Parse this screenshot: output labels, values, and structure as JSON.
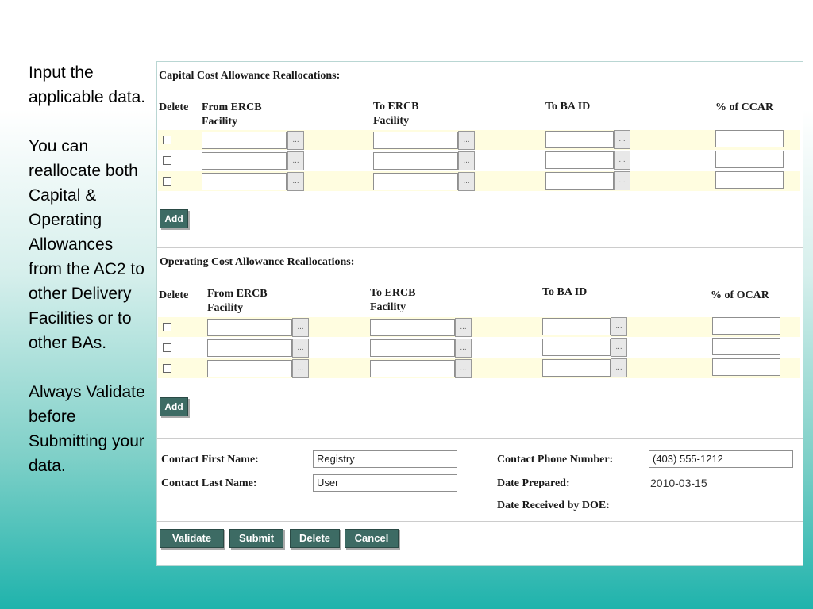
{
  "notes": {
    "p1": "Input the applicable data.",
    "p2": "You can reallocate both Capital & Operating Allowances from the AC2 to other Delivery Facilities or to other BAs.",
    "p3": "Always Validate before Submitting your data."
  },
  "capital": {
    "title": "Capital Cost Allowance Reallocations:",
    "col_delete": "Delete",
    "col_from": "From ERCB Facility",
    "col_to": "To ERCB Facility",
    "col_ba": "To BA ID",
    "col_pct": "% of CCAR",
    "lookup_label": "...",
    "add_label": "Add"
  },
  "operating": {
    "title": "Operating Cost Allowance Reallocations:",
    "col_delete": "Delete",
    "col_from": "From ERCB Facility",
    "col_to": "To ERCB Facility",
    "col_ba": "To BA ID",
    "col_pct": "% of OCAR",
    "lookup_label": "...",
    "add_label": "Add"
  },
  "contact": {
    "first_label": "Contact First Name:",
    "first_value": "Registry",
    "last_label": "Contact Last Name:",
    "last_value": "User",
    "phone_label": "Contact Phone Number:",
    "phone_value": "(403) 555-1212",
    "date_prepared_label": "Date Prepared:",
    "date_prepared_value": "2010-03-15",
    "date_received_label": "Date Received by DOE:"
  },
  "actions": {
    "validate": "Validate",
    "submit": "Submit",
    "delete": "Delete",
    "cancel": "Cancel"
  },
  "colors": {
    "button_bg": "#3d6b64",
    "row_highlight": "#fffde0"
  }
}
